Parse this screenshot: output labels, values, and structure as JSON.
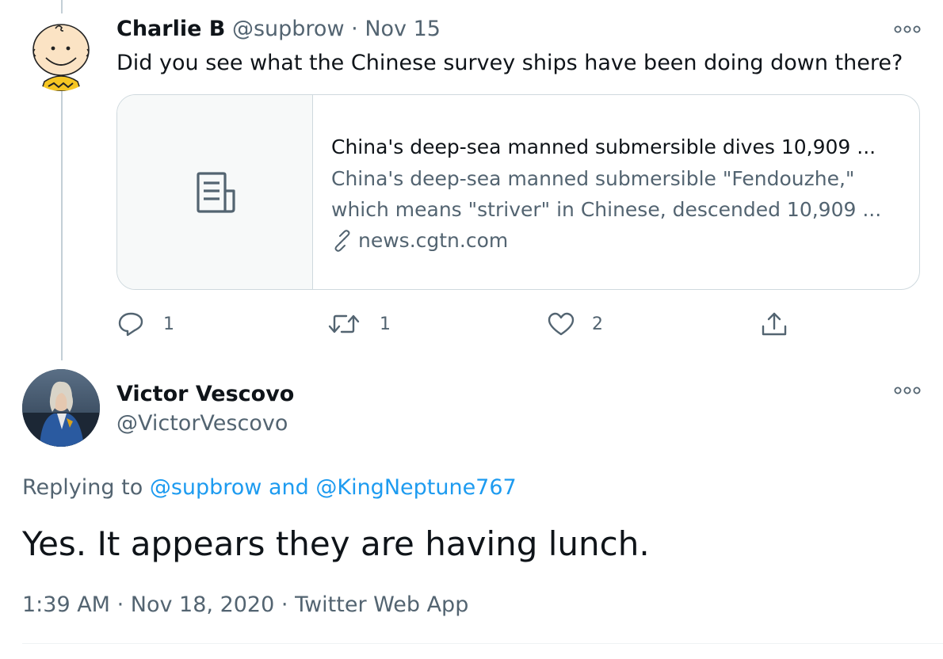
{
  "tweet1": {
    "display_name": "Charlie B",
    "handle": "@supbrow",
    "separator": "·",
    "date": "Nov 15",
    "text": "Did you see what the Chinese survey ships have been doing down there?",
    "avatar_icon": "charlie-brown-avatar",
    "more_icon": "more-options-icon",
    "link_card": {
      "thumb_icon": "document-icon",
      "title": "China's deep-sea manned submersible dives 10,909 ...",
      "description_line1": "China's deep-sea manned submersible \"Fendouzhe,\"",
      "description_line2": "which means \"striver\" in Chinese, descended 10,909 ...",
      "domain": "news.cgtn.com",
      "domain_icon": "link-icon"
    },
    "actions": {
      "reply_count": "1",
      "retweet_count": "1",
      "like_count": "2"
    }
  },
  "tweet2": {
    "display_name": "Victor Vescovo",
    "handle": "@VictorVescovo",
    "avatar_icon": "profile-photo-avatar",
    "more_icon": "more-options-icon",
    "replying_prefix": "Replying to ",
    "reply_to_1": "@supbrow",
    "reply_joiner": " and ",
    "reply_to_2": "@KingNeptune767",
    "text": "Yes. It appears they are having lunch.",
    "time": "1:39 AM",
    "separator": "·",
    "date": "Nov 18, 2020",
    "source": "Twitter Web App"
  },
  "colors": {
    "text_primary": "#0f1419",
    "text_secondary": "#536471",
    "link_blue": "#1d9bf0",
    "border": "#cfd9de"
  }
}
